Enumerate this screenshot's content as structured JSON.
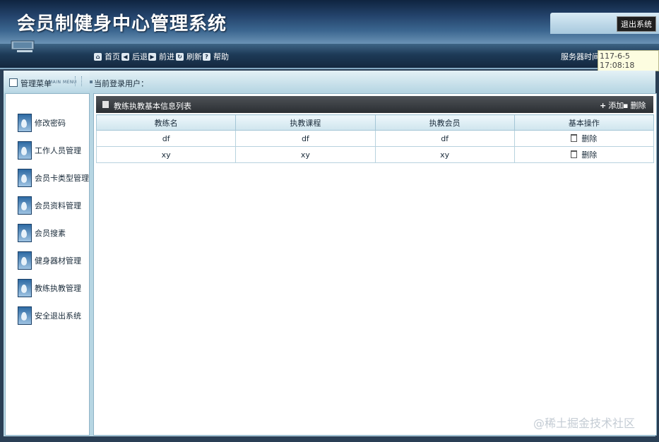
{
  "header": {
    "title": "会员制健身中心管理系统",
    "logout_label": "退出系统"
  },
  "nav": {
    "items": [
      {
        "label": "首页",
        "icon": "home-icon"
      },
      {
        "label": "后退",
        "icon": "back-icon"
      },
      {
        "label": "前进",
        "icon": "forward-icon"
      },
      {
        "label": "刷新",
        "icon": "refresh-icon"
      },
      {
        "label": "帮助",
        "icon": "help-icon"
      }
    ],
    "server_time_label": "服务器时间：",
    "server_time": "117-6-5 17:08:18"
  },
  "menu": {
    "title": "管理菜单",
    "subtitle": "MAIN MENU",
    "items": [
      {
        "label": "修改密码"
      },
      {
        "label": "工作人员管理"
      },
      {
        "label": "会员卡类型管理"
      },
      {
        "label": "会员资料管理"
      },
      {
        "label": "会员搜素"
      },
      {
        "label": "健身器材管理"
      },
      {
        "label": "教练执教管理"
      },
      {
        "label": "安全退出系统"
      }
    ]
  },
  "userbar": {
    "label": "当前登录用户："
  },
  "list": {
    "title": "教练执教基本信息列表",
    "add_label": "添加",
    "delete_label": "删除",
    "columns": [
      "教练名",
      "执教课程",
      "执教会员",
      "基本操作"
    ],
    "rows": [
      {
        "coach": "df",
        "course": "df",
        "member": "df",
        "action": "删除"
      },
      {
        "coach": "xy",
        "course": "xy",
        "member": "xy",
        "action": "删除"
      }
    ]
  },
  "watermark": "@稀土掘金技术社区"
}
